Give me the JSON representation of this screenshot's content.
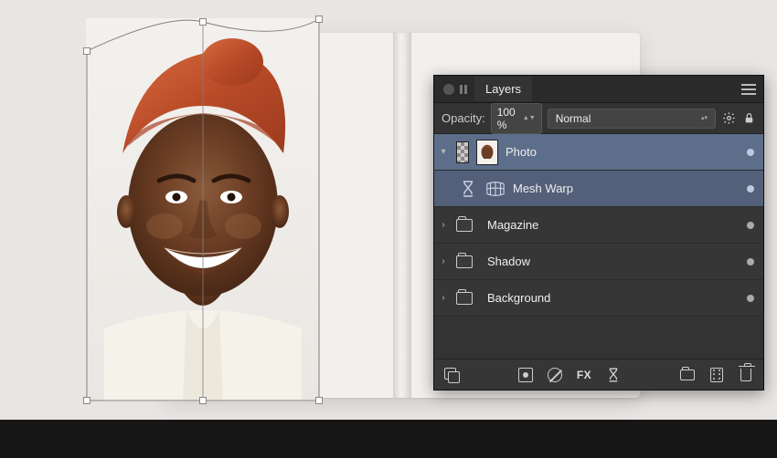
{
  "panel": {
    "tab_label": "Layers",
    "opacity_label": "Opacity:",
    "opacity_value": "100 %",
    "blend_mode": "Normal",
    "layers": [
      {
        "name": "Photo",
        "kind": "pixel",
        "selected": true,
        "expanded": true
      },
      {
        "name": "Mesh Warp",
        "kind": "filter",
        "selected": true,
        "child": true
      },
      {
        "name": "Magazine",
        "kind": "group",
        "selected": false
      },
      {
        "name": "Shadow",
        "kind": "group",
        "selected": false
      },
      {
        "name": "Background",
        "kind": "group",
        "selected": false
      }
    ],
    "footer_icons": {
      "layers_stack": "layers-stack",
      "mask": "add-mask",
      "adjust": "adjustment",
      "fx": "FX",
      "hourglass": "live-filter",
      "folder": "new-group",
      "grid": "options",
      "trash": "delete"
    }
  },
  "icons": {
    "gear": "gear-icon",
    "lock": "lock-icon",
    "menu": "menu-icon",
    "chevrons": "stepper-icon"
  }
}
